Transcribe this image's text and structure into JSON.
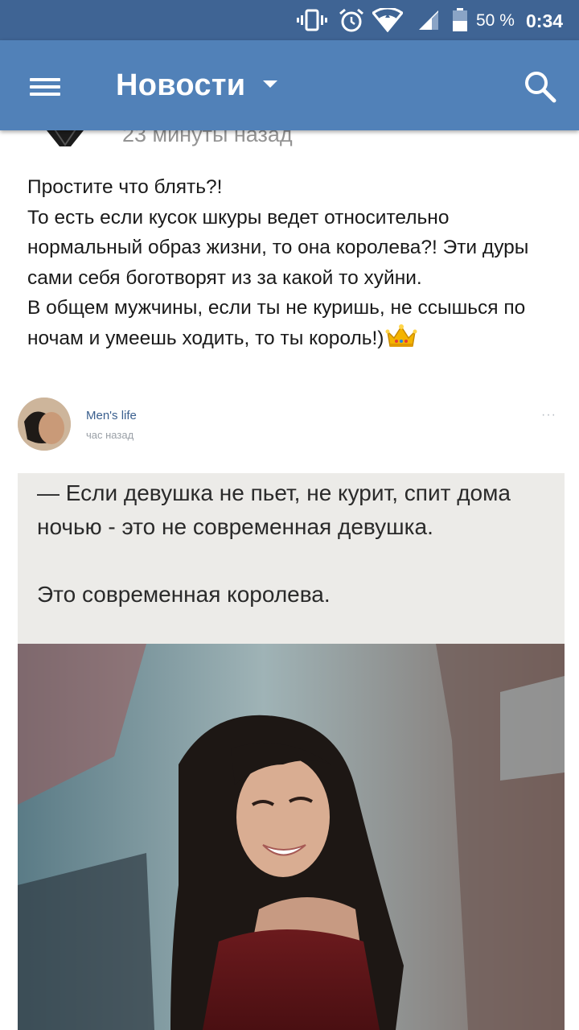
{
  "status_bar": {
    "battery_percent": "50 %",
    "time": "0:34"
  },
  "app_bar": {
    "title": "Новости"
  },
  "post": {
    "time_ago": "23 минуты назад",
    "text": "Простите что блять?!\nТо есть если кусок шкуры ведет относительно нормальный образ жизни, то она королева?! Эти дуры сами себя боготворят из за какой то хуйни.\nВ общем мужчины, если ты не куришь, не ссышься по ночам и умеешь ходить, то ты король!)",
    "emoji": "crown-emoji"
  },
  "repost": {
    "author": "Men's life",
    "time_ago": "час назад",
    "more": "···",
    "image_text": "— Если девушка не пьет, не курит, спит дома ночью - это не современная девушка.\n\nЭто современная королева."
  },
  "colors": {
    "status_bar": "#3f6494",
    "app_bar": "#5181b8",
    "link": "#3a5f8e"
  }
}
